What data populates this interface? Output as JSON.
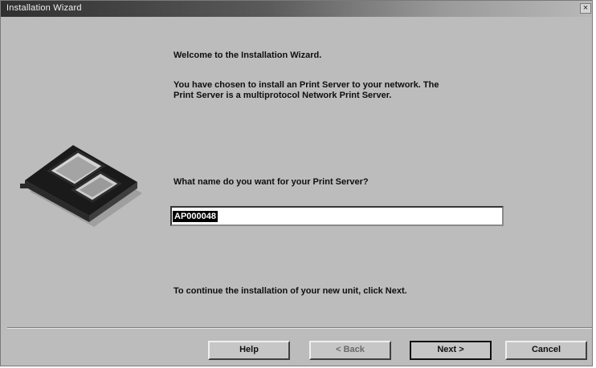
{
  "window": {
    "title": "Installation Wizard",
    "close_label": "×"
  },
  "wizard": {
    "welcome": "Welcome to the Installation Wizard.",
    "intro_line1": "You have chosen to install an Print Server to your network. The",
    "intro_line2": "Print Server is a multiprotocol Network Print Server.",
    "question": "What name do you want for your Print Server?",
    "server_name_value": "AP000048",
    "continue_hint": "To continue the installation of your new unit, click Next."
  },
  "icons": {
    "device": "print-server-device-icon"
  },
  "buttons": {
    "help": "Help",
    "back": "< Back",
    "next": "Next >",
    "cancel": "Cancel"
  }
}
